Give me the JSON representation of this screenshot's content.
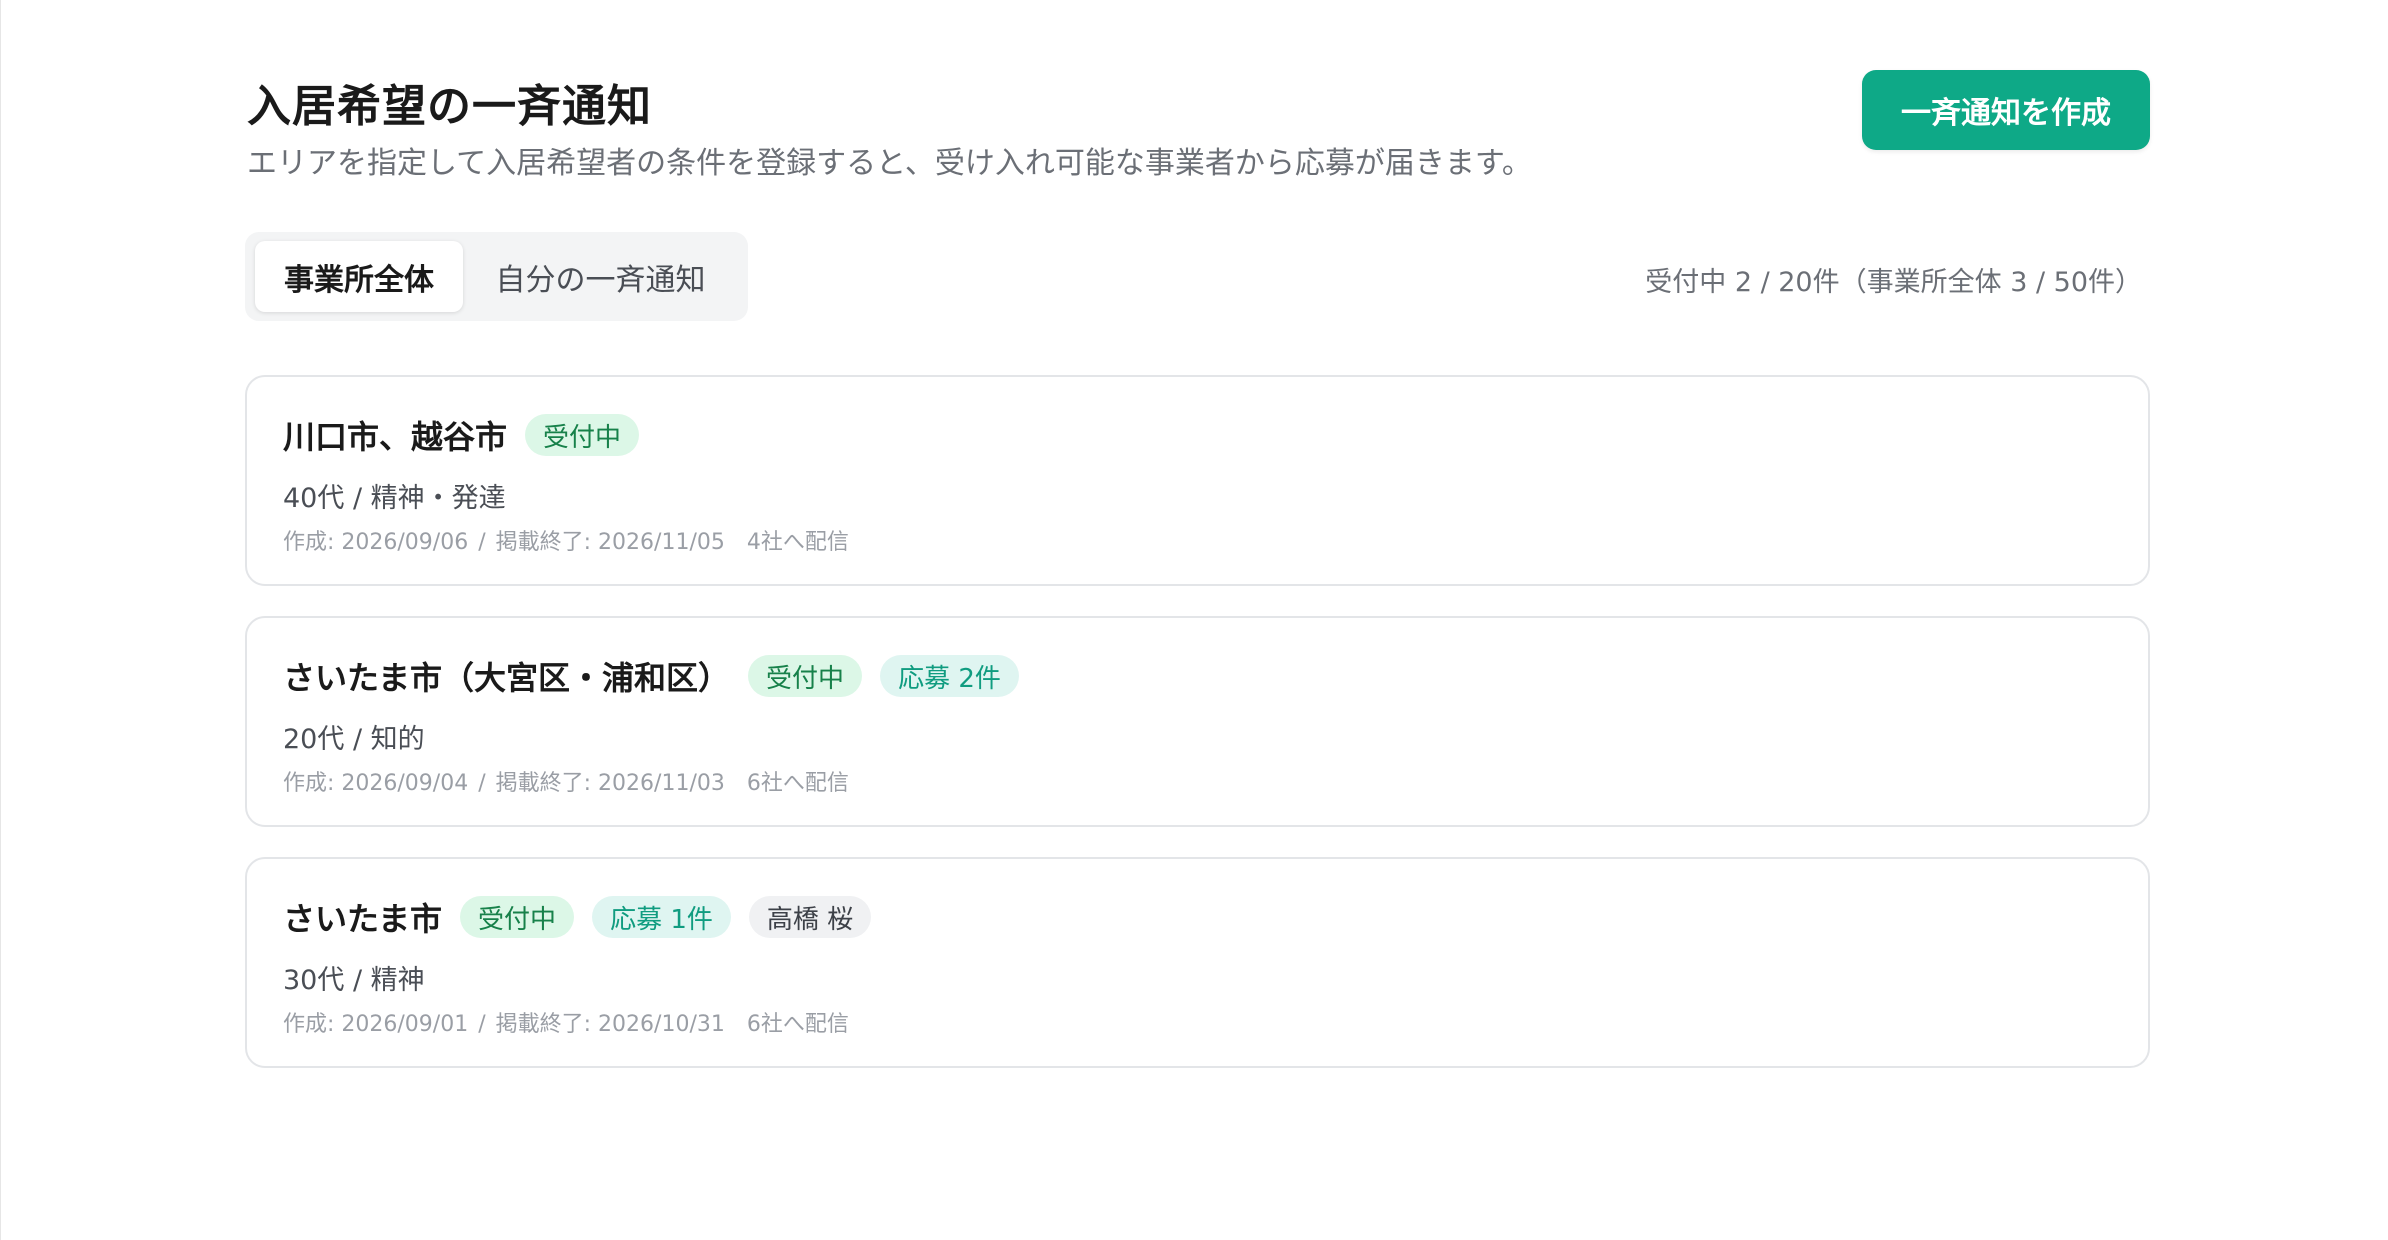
{
  "header": {
    "title": "入居希望の一斉通知",
    "subtitle": "エリアを指定して入居希望者の条件を登録すると、受け入れ可能な事業者から応募が届きます。",
    "create_button_label": "一斉通知を作成"
  },
  "tabs": [
    {
      "label": "事業所全体",
      "active": true
    },
    {
      "label": "自分の一斉通知",
      "active": false
    }
  ],
  "summary": "受付中 2 / 20件（事業所全体 3 / 50件）",
  "colors": {
    "accent": "#0ea987",
    "badge_open_bg": "#dcf7e7",
    "badge_open_text": "#17814a",
    "badge_apply_bg": "#dff5f1",
    "badge_apply_text": "#109c80"
  },
  "cards": [
    {
      "title": "川口市、越谷市",
      "status_badge": "受付中",
      "meta": "40代 / 精神・発達",
      "created": "作成: 2026/09/06",
      "separator": "/",
      "ends": "掲載終了: 2026/11/05",
      "delivered": "4社へ配信"
    },
    {
      "title": "さいたま市（大宮区・浦和区）",
      "status_badge": "受付中",
      "apply_badge": "応募 2件",
      "meta": "20代 / 知的",
      "created": "作成: 2026/09/04",
      "separator": "/",
      "ends": "掲載終了: 2026/11/03",
      "delivered": "6社へ配信"
    },
    {
      "title": "さいたま市",
      "status_badge": "受付中",
      "apply_badge": "応募 1件",
      "person_badge": "高橋 桜",
      "meta": "30代 / 精神",
      "created": "作成: 2026/09/01",
      "separator": "/",
      "ends": "掲載終了: 2026/10/31",
      "delivered": "6社へ配信"
    }
  ]
}
